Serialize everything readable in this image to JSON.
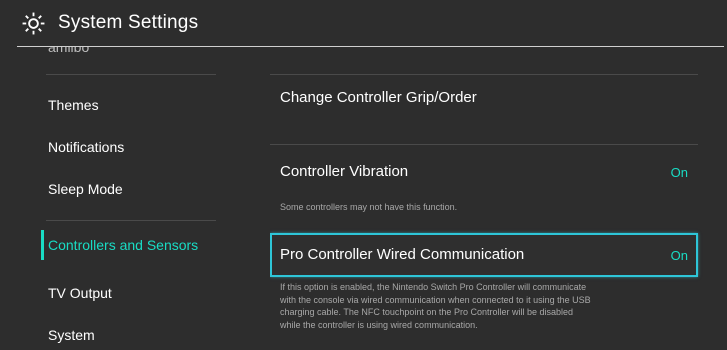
{
  "header": {
    "title": "System Settings",
    "icon": "gear-icon"
  },
  "sidebar": {
    "items": [
      {
        "label": "amiibo"
      },
      {
        "label": "Themes"
      },
      {
        "label": "Notifications"
      },
      {
        "label": "Sleep Mode"
      },
      {
        "label": "Controllers and Sensors",
        "selected": true
      },
      {
        "label": "TV Output"
      },
      {
        "label": "System"
      }
    ]
  },
  "content": {
    "rows": [
      {
        "label": "Change Controller Grip/Order"
      },
      {
        "label": "Controller Vibration",
        "value": "On",
        "description": "Some controllers may not have this function."
      },
      {
        "label": "Pro Controller Wired Communication",
        "value": "On",
        "focused": true,
        "description": [
          "If this option is enabled, the Nintendo Switch Pro Controller will communicate",
          "with the console via wired communication when connected to it using the USB",
          "charging cable. The NFC touchpoint on the Pro Controller will be disabled",
          "while the controller is using wired communication."
        ]
      }
    ]
  },
  "colors": {
    "background": "#2d2d2d",
    "accent": "#19dcc4",
    "focus_border": "#2ec6d8"
  }
}
